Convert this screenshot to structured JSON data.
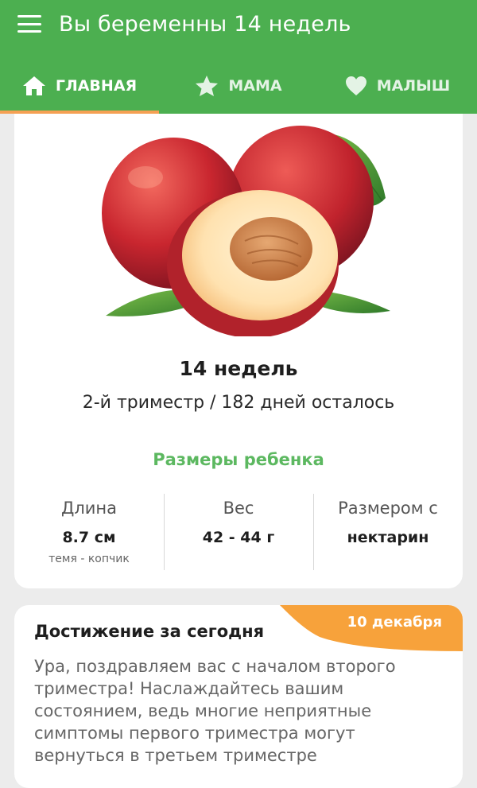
{
  "header": {
    "title": "Вы беременны 14 недель",
    "menu_icon": "hamburger-menu-icon",
    "background": "#4caf50"
  },
  "tabs": [
    {
      "label": "ГЛАВНАЯ",
      "icon": "home-icon",
      "active": true
    },
    {
      "label": "МАМА",
      "icon": "star-icon",
      "active": false
    },
    {
      "label": "МАЛЫШ",
      "icon": "heart-icon",
      "active": false
    }
  ],
  "tab_indicator_color": "#f5a053",
  "week_card": {
    "illustration": "nectarine-illustration",
    "weeks": "14 недель",
    "trimester_info": "2-й триместр / 182 дней осталось",
    "sizes_heading": "Размеры ребенка",
    "stats": [
      {
        "label": "Длина",
        "value": "8.7 см",
        "sub": "темя - копчик"
      },
      {
        "label": "Вес",
        "value": "42 - 44 г",
        "sub": ""
      },
      {
        "label": "Размером с",
        "value": "нектарин",
        "sub": ""
      }
    ]
  },
  "achievement": {
    "title": "Достижение за сегодня",
    "date": "10 декабря",
    "text": "Ура, поздравляем вас с началом второго триместра! Наслаждайтесь вашим состоянием, ведь многие неприятные симптомы первого триместра могут вернуться в третьем триместре",
    "accent": "#f7a23b"
  }
}
